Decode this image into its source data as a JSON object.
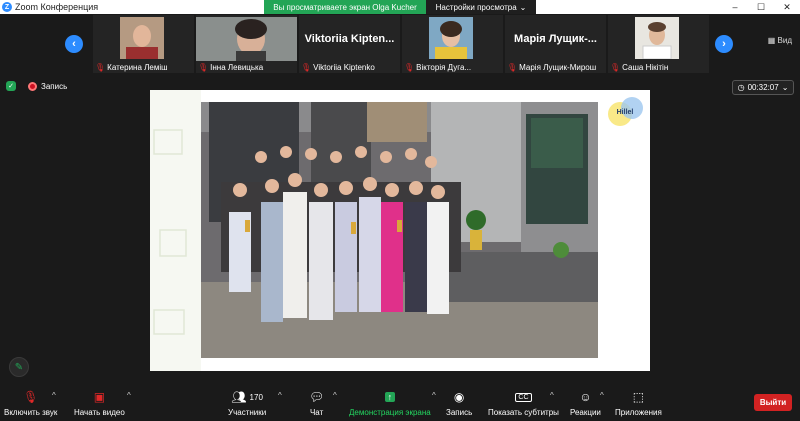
{
  "window": {
    "title": "Zoom Конференция",
    "share_banner": "Вы просматриваете экран Olga Kucher",
    "view_options": "Настройки просмотра"
  },
  "gallery": {
    "view_label": "Вид",
    "participants": [
      {
        "name": "Катерина Леміш"
      },
      {
        "name": "Інна Левицька"
      },
      {
        "name": "Viktoriia Kiptenko",
        "display": "Viktoriia Kipten..."
      },
      {
        "name": "Вікторія Дуга..."
      },
      {
        "name": "Марія Лущик-Мирош",
        "display": "Марія Лущик-..."
      },
      {
        "name": "Саша Нікітін"
      }
    ]
  },
  "status": {
    "recording_label": "Запись",
    "timer": "00:32:07"
  },
  "toolbar": {
    "unmute": "Включить звук",
    "start_video": "Начать видео",
    "participants": "Участники",
    "participants_count": "170",
    "chat": "Чат",
    "share_screen": "Демонстрация экрана",
    "record": "Запись",
    "captions": "Показать субтитры",
    "captions_badge": "CC",
    "reactions": "Реакции",
    "apps": "Приложения",
    "leave": "Выйти"
  },
  "shared_slide": {
    "logo_text": "Hillel"
  },
  "colors": {
    "accent_blue": "#2d8cff",
    "share_green": "#23a556",
    "leave_red": "#d22222",
    "background": "#1a1a1a"
  }
}
